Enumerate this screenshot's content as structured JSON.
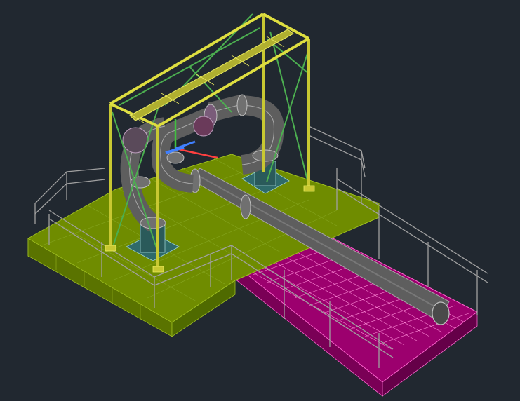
{
  "viewport": {
    "background": "#212830",
    "content": "cad-3d-model"
  },
  "model": {
    "colors": {
      "deck": "#6f8c00",
      "deck_edge": "#4f6a00",
      "deck_side": "#5a7300",
      "frame": "#c8c832",
      "bracing": "#4caf50",
      "pipe": "#6a6a6a",
      "pipe_dark": "#4c4c4c",
      "flange": "#9a9a9a",
      "pedestal": "#2f6a6a",
      "float_cube": "#b0007c",
      "float_edge": "#ff66d0",
      "railing": "#9a9a9a"
    }
  },
  "ucs_icon": {
    "axes": [
      "x-axis-red",
      "y-axis-green",
      "z-axis-blue"
    ],
    "colors": [
      "#ff4040",
      "#40c040",
      "#4080ff"
    ]
  }
}
